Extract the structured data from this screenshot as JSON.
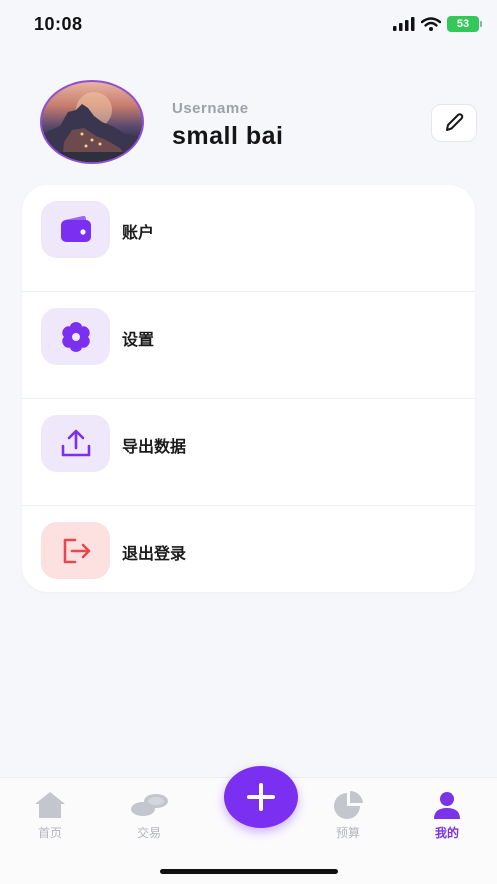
{
  "status": {
    "time": "10:08",
    "battery": "53"
  },
  "profile": {
    "username_label": "Username",
    "username": "small bai"
  },
  "menu": [
    {
      "label": "账户",
      "icon": "wallet-icon"
    },
    {
      "label": "设置",
      "icon": "gear-icon"
    },
    {
      "label": "导出数据",
      "icon": "upload-icon"
    },
    {
      "label": "退出登录",
      "icon": "logout-icon"
    }
  ],
  "tabs": [
    {
      "label": "首页",
      "icon": "home-icon"
    },
    {
      "label": "交易",
      "icon": "coins-icon"
    },
    {
      "label": "预算",
      "icon": "pie-chart-icon"
    },
    {
      "label": "我的",
      "icon": "user-icon",
      "active": true
    }
  ],
  "colors": {
    "accent": "#7b2ff0",
    "danger": "#e5484d",
    "background": "#f6f7fa"
  }
}
